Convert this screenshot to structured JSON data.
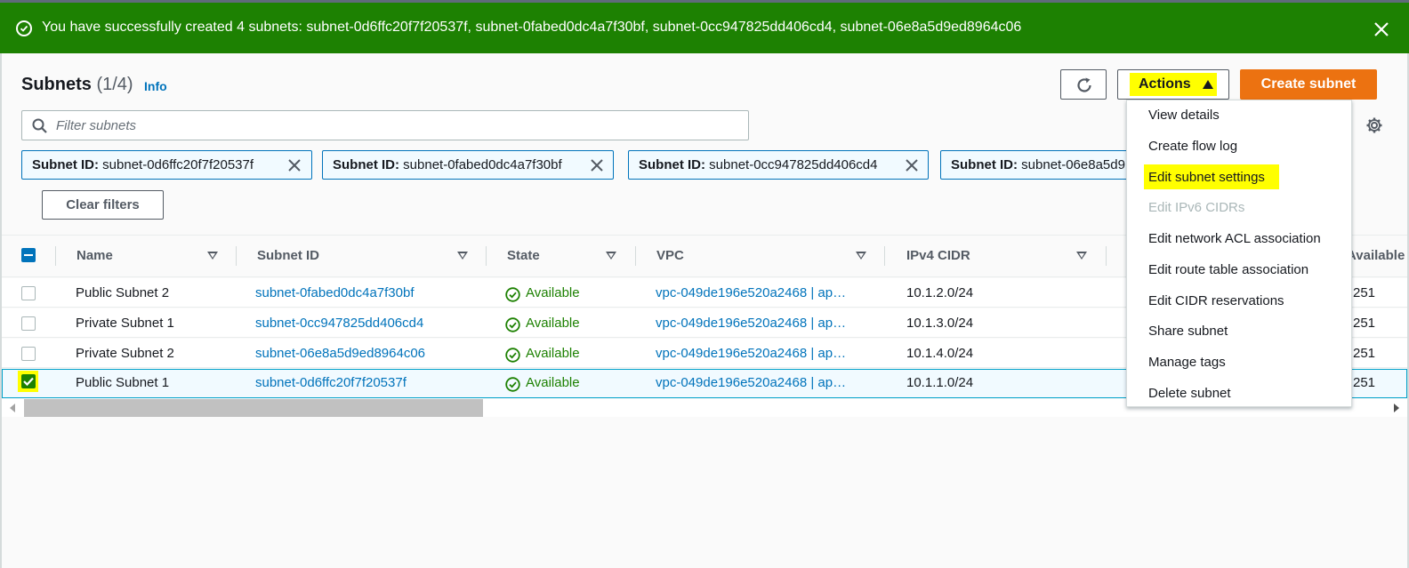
{
  "flash": {
    "message": "You have successfully created 4 subnets: subnet-0d6ffc20f7f20537f, subnet-0fabed0dc4a7f30bf, subnet-0cc947825dd406cd4, subnet-06e8a5d9ed8964c06",
    "color": "#1d8102"
  },
  "header": {
    "title": "Subnets",
    "count": "(1/4)",
    "info_link": "Info"
  },
  "toolbar": {
    "actions_label": "Actions",
    "create_label": "Create subnet"
  },
  "search": {
    "placeholder": "Filter subnets"
  },
  "filters": {
    "key": "Subnet ID:",
    "tokens": [
      "subnet-0d6ffc20f7f20537f",
      "subnet-0fabed0dc4a7f30bf",
      "subnet-0cc947825dd406cd4",
      "subnet-06e8a5d9"
    ],
    "clear_label": "Clear filters"
  },
  "table": {
    "columns": [
      "Name",
      "Subnet ID",
      "State",
      "VPC",
      "IPv4 CIDR",
      "Available"
    ],
    "rows": [
      {
        "name": "Public Subnet 2",
        "subnet_id": "subnet-0fabed0dc4a7f30bf",
        "state": "Available",
        "vpc": "vpc-049de196e520a2468 | ap…",
        "cidr": "10.1.2.0/24",
        "available": "251",
        "selected": false
      },
      {
        "name": "Private Subnet 1",
        "subnet_id": "subnet-0cc947825dd406cd4",
        "state": "Available",
        "vpc": "vpc-049de196e520a2468 | ap…",
        "cidr": "10.1.3.0/24",
        "available": "251",
        "selected": false
      },
      {
        "name": "Private Subnet 2",
        "subnet_id": "subnet-06e8a5d9ed8964c06",
        "state": "Available",
        "vpc": "vpc-049de196e520a2468 | ap…",
        "cidr": "10.1.4.0/24",
        "available": "251",
        "selected": false
      },
      {
        "name": "Public Subnet 1",
        "subnet_id": "subnet-0d6ffc20f7f20537f",
        "state": "Available",
        "vpc": "vpc-049de196e520a2468 | ap…",
        "cidr": "10.1.1.0/24",
        "available": "251",
        "selected": true
      }
    ]
  },
  "actions_menu": {
    "items": [
      {
        "label": "View details",
        "disabled": false
      },
      {
        "label": "Create flow log",
        "disabled": false
      },
      {
        "label": "Edit subnet settings",
        "disabled": false,
        "highlighted": true
      },
      {
        "label": "Edit IPv6 CIDRs",
        "disabled": true
      },
      {
        "label": "Edit network ACL association",
        "disabled": false
      },
      {
        "label": "Edit route table association",
        "disabled": false
      },
      {
        "label": "Edit CIDR reservations",
        "disabled": false
      },
      {
        "label": "Share subnet",
        "disabled": false
      },
      {
        "label": "Manage tags",
        "disabled": false
      },
      {
        "label": "Delete subnet",
        "disabled": false
      }
    ]
  },
  "colors": {
    "accent": "#0073bb",
    "primary_button": "#ec7211",
    "success": "#1d8102",
    "highlighter": "#ffff00"
  }
}
